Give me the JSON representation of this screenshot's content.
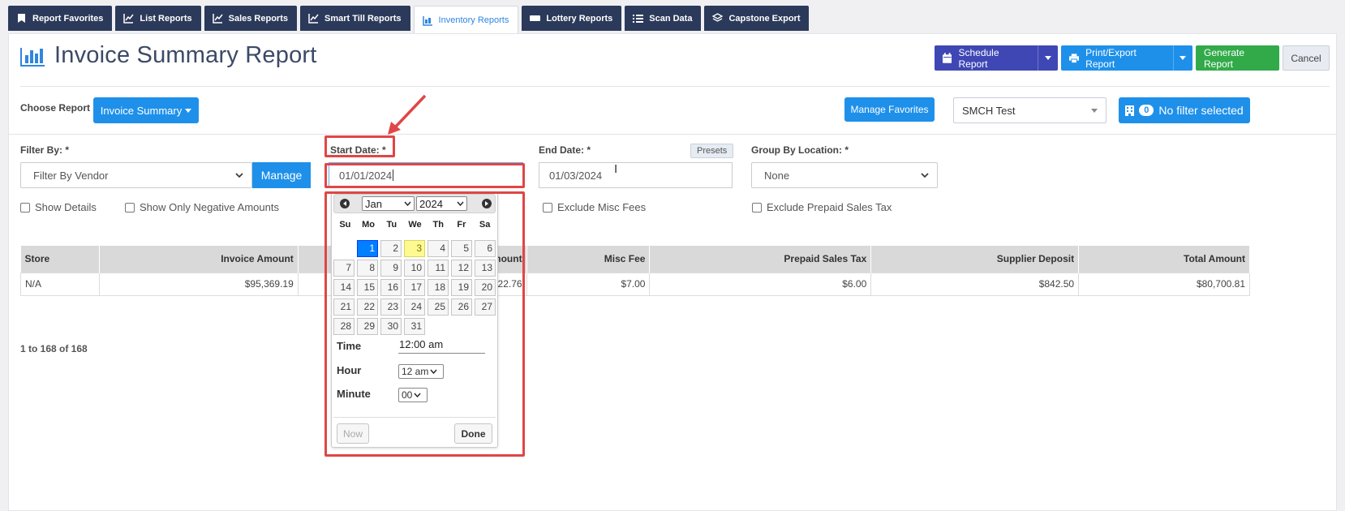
{
  "tabs": [
    {
      "label": "Report Favorites",
      "icon": "bookmark-icon",
      "active": false
    },
    {
      "label": "List Reports",
      "icon": "chart-line-icon",
      "active": false
    },
    {
      "label": "Sales Reports",
      "icon": "chart-line-icon",
      "active": false
    },
    {
      "label": "Smart Till Reports",
      "icon": "chart-line-icon",
      "active": false
    },
    {
      "label": "Inventory Reports",
      "icon": "inventory-icon",
      "active": true
    },
    {
      "label": "Lottery Reports",
      "icon": "ticket-icon",
      "active": false
    },
    {
      "label": "Scan Data",
      "icon": "list-icon",
      "active": false
    },
    {
      "label": "Capstone Export",
      "icon": "layers-icon",
      "active": false
    }
  ],
  "header": {
    "title": "Invoice Summary Report",
    "schedule_label": "Schedule Report",
    "print_label": "Print/Export Report",
    "generate_label": "Generate Report",
    "cancel_label": "Cancel"
  },
  "report_bar": {
    "choose_label": "Choose Report",
    "choose_value": "Invoice Summary",
    "manage_favorites_label": "Manage Favorites",
    "store_value": "SMCH Test",
    "filter_count": "0",
    "filter_label": "No filter selected"
  },
  "filters": {
    "filter_by_label": "Filter By: *",
    "filter_by_value": "Filter By Vendor",
    "manage_label": "Manage",
    "start_date_label": "Start Date: *",
    "start_date_value": "01/01/2024",
    "end_date_label": "End Date: *",
    "end_date_value": "01/03/2024",
    "presets_label": "Presets",
    "group_by_label": "Group By Location: *",
    "group_by_value": "None",
    "checkboxes": [
      "Show Details",
      "Show Only Negative Amounts",
      "Exclude Misc Fees",
      "Exclude Prepaid Sales Tax"
    ]
  },
  "table": {
    "headers": [
      "Store",
      "Invoice Amount",
      "amount",
      "Misc Fee",
      "Prepaid Sales Tax",
      "Supplier Deposit",
      "Total Amount"
    ],
    "row": [
      "N/A",
      "$95,369.19",
      "22.76",
      "$7.00",
      "$6.00",
      "$842.50",
      "$80,700.81"
    ],
    "pager": "1 to 168 of 168"
  },
  "datepicker": {
    "month": "Jan",
    "year": "2024",
    "weekdays": [
      "Su",
      "Mo",
      "Tu",
      "We",
      "Th",
      "Fr",
      "Sa"
    ],
    "days": [
      "",
      "1",
      "2",
      "3",
      "4",
      "5",
      "6",
      "7",
      "8",
      "9",
      "10",
      "11",
      "12",
      "13",
      "14",
      "15",
      "16",
      "17",
      "18",
      "19",
      "20",
      "21",
      "22",
      "23",
      "24",
      "25",
      "26",
      "27",
      "28",
      "29",
      "30",
      "31"
    ],
    "selected_day": "1",
    "today_day": "3",
    "time_label": "Time",
    "time_value": "12:00 am",
    "hour_label": "Hour",
    "hour_value": "12 am",
    "minute_label": "Minute",
    "minute_value": "00",
    "now_label": "Now",
    "done_label": "Done"
  },
  "colors": {
    "tab_bg": "#2b3a5a",
    "primary_blue": "#1e90ea",
    "indigo": "#3f47b5",
    "green": "#32aa4a",
    "annotation_red": "#e04646"
  }
}
